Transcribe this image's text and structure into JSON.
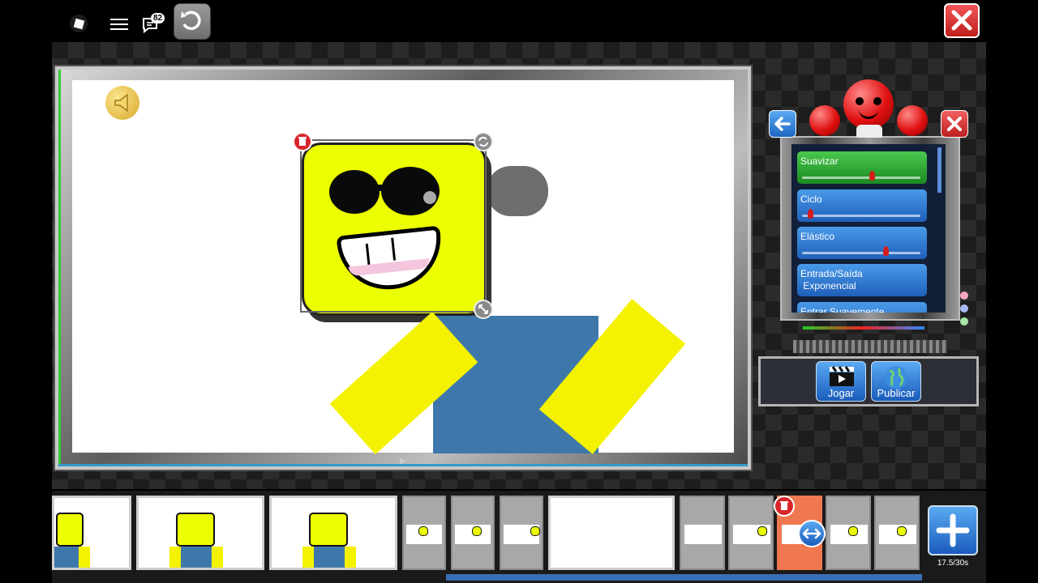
{
  "topbar": {
    "logo_icon": "roblox-logo-icon",
    "menu_icon": "hamburger-menu-icon",
    "chat_icon": "chat-bubble-icon",
    "chat_badge": "82",
    "undo_icon": "undo-icon",
    "close_icon": "close-x-icon"
  },
  "stage": {
    "speaker_icon": "speaker-icon",
    "selection": {
      "delete_icon": "trash-icon",
      "rotate_icon": "rotate-icon",
      "resize_icon": "resize-icon"
    }
  },
  "easing_panel": {
    "back_icon": "arrow-left-icon",
    "close_icon": "close-x-icon",
    "items": [
      {
        "label": "Suavizar",
        "value": 0.6,
        "active": true
      },
      {
        "label": "Ciclo",
        "value": 0.05,
        "active": false
      },
      {
        "label": "Elástico",
        "value": 0.72,
        "active": false
      },
      {
        "label": "Entrada/Saída\n Exponencial",
        "value": null,
        "active": false
      },
      {
        "label": "Entrar Suavemente",
        "value": null,
        "active": false
      }
    ]
  },
  "actions": {
    "play_label": "Jogar",
    "play_icon": "clapperboard-icon",
    "publish_label": "Publicar",
    "publish_icon": "globe-icon"
  },
  "timeline": {
    "delete_icon": "trash-icon",
    "move_icon": "double-arrow-icon",
    "add_icon": "plus-icon",
    "duration": "17.5/30s",
    "progress": 0.58
  },
  "colors": {
    "accent_blue": "#1f5fb9",
    "active_green": "#1c8a23",
    "danger_red": "#d21d1d",
    "selected_frame": "#f07850",
    "character_yellow": "#ecff00",
    "character_blue": "#3e78aa"
  }
}
